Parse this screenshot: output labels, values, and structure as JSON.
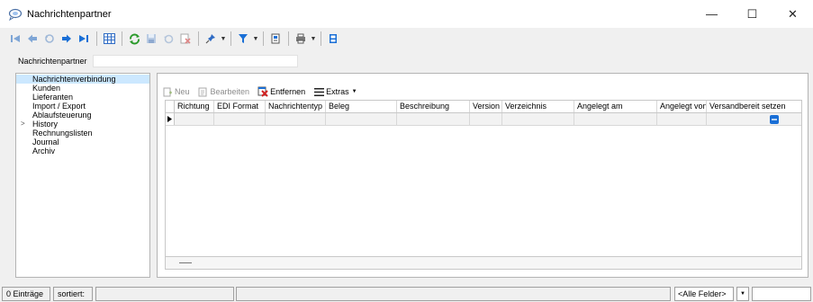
{
  "window": {
    "title": "Nachrichtenpartner",
    "minimize": "—",
    "maximize": "☐",
    "close": "✕"
  },
  "search": {
    "label": "Nachrichtenpartner",
    "value": ""
  },
  "tree": [
    {
      "label": "Nachrichtenverbindung",
      "selected": true
    },
    {
      "label": "Kunden"
    },
    {
      "label": "Lieferanten"
    },
    {
      "label": "Import / Export"
    },
    {
      "label": "Ablaufsteuerung"
    },
    {
      "label": "History",
      "expandable": true
    },
    {
      "label": "Rechnungslisten"
    },
    {
      "label": "Journal"
    },
    {
      "label": "Archiv"
    }
  ],
  "subtoolbar": {
    "new": "Neu",
    "edit": "Bearbeiten",
    "remove": "Entfernen",
    "extras": "Extras"
  },
  "grid": {
    "columns": [
      "Richtung",
      "EDI Format",
      "Nachrichtentyp",
      "Beleg",
      "Beschreibung",
      "Version",
      "Verzeichnis",
      "Angelegt am",
      "Angelegt von",
      "Versandbereit setzen"
    ]
  },
  "status": {
    "count": "0 Einträge",
    "sorted": "sortiert:",
    "filter": "<Alle Felder>"
  },
  "colors": {
    "accent": "#1a6fd6",
    "selection": "#cce8ff",
    "remove_red": "#d02020"
  }
}
